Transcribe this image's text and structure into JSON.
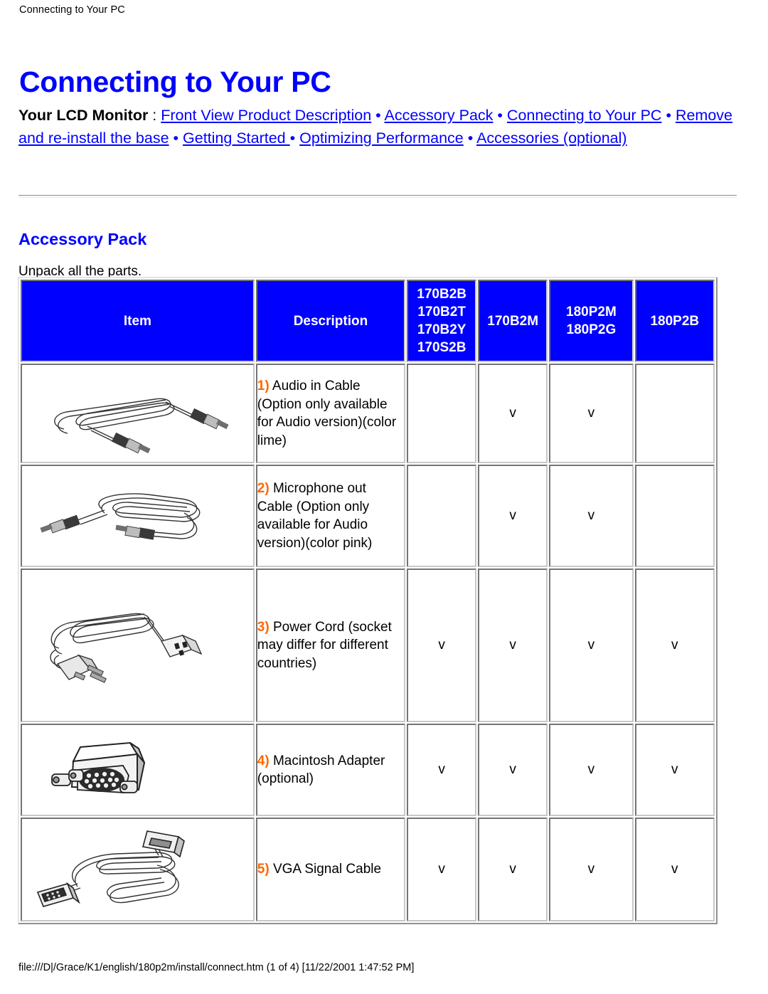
{
  "browser": {
    "print_header": "Connecting to Your PC",
    "file_footer": "file:///D|/Grace/K1/english/180p2m/install/connect.htm (1 of 4) [11/22/2001 1:47:52 PM]"
  },
  "colors": {
    "link": "#0000ff",
    "heading": "#0000ff",
    "header_cell_bg": "#0000ff",
    "header_cell_text": "#ffffff",
    "item_number": "#ff6600",
    "body_text": "#000000"
  },
  "page_title": "Connecting to Your PC",
  "nav": {
    "lead_label": "Your LCD Monitor",
    "colon": " : ",
    "separator": " • ",
    "links": [
      "Front View Product Description",
      "Accessory Pack",
      "Connecting to Your PC",
      "Remove and re-install the base",
      "Getting Started ",
      "Optimizing Performance",
      "Accessories (optional)"
    ]
  },
  "section": {
    "heading": "Accessory Pack",
    "intro": "Unpack all the parts."
  },
  "table": {
    "headers": {
      "item": "Item",
      "description": "Description",
      "model_group_1": [
        "170B2B",
        "170B2T",
        "170B2Y",
        "170S2B"
      ],
      "model_group_2": [
        "170B2M"
      ],
      "model_group_3": [
        "180P2M",
        "180P2G"
      ],
      "model_group_4": [
        "180P2B"
      ]
    },
    "mark": "v",
    "rows": [
      {
        "number": "1)",
        "icon": "audio-cable-image",
        "description": " Audio in Cable (Option only available for Audio version)(color lime)",
        "marks": [
          "",
          "v",
          "v",
          ""
        ]
      },
      {
        "number": "2)",
        "icon": "microphone-cable-image",
        "description": " Microphone out Cable (Option only available for Audio version)(color pink)",
        "marks": [
          "",
          "v",
          "v",
          ""
        ]
      },
      {
        "number": "3)",
        "icon": "power-cord-image",
        "description": " Power Cord (socket may differ for different countries)",
        "marks": [
          "v",
          "v",
          "v",
          "v"
        ]
      },
      {
        "number": "4)",
        "icon": "macintosh-adapter-image",
        "description": " Macintosh Adapter (optional)",
        "marks": [
          "v",
          "v",
          "v",
          "v"
        ]
      },
      {
        "number": "5)",
        "icon": "vga-signal-cable-image",
        "description": " VGA Signal Cable",
        "marks": [
          "v",
          "v",
          "v",
          "v"
        ]
      }
    ]
  }
}
